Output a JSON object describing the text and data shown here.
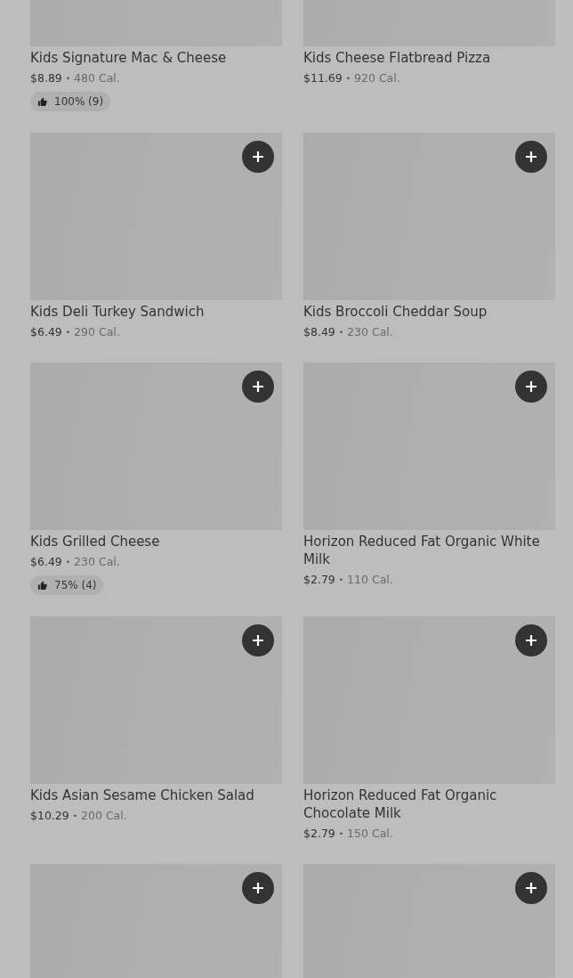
{
  "items": [
    {
      "name": "Kids Signature Mac & Cheese",
      "price": "$8.89",
      "separator": "•",
      "calories": "480 Cal.",
      "rating": "100% (9)"
    },
    {
      "name": "Kids Cheese Flatbread Pizza",
      "price": "$11.69",
      "separator": "•",
      "calories": "920 Cal."
    },
    {
      "name": "Kids Deli Turkey Sandwich",
      "price": "$6.49",
      "separator": "•",
      "calories": "290 Cal.",
      "add_button": true
    },
    {
      "name": "Kids Broccoli Cheddar Soup",
      "price": "$8.49",
      "separator": "•",
      "calories": "230 Cal.",
      "add_button": true
    },
    {
      "name": "Kids Grilled Cheese",
      "price": "$6.49",
      "separator": "•",
      "calories": "230 Cal.",
      "rating": "75% (4)",
      "add_button": true
    },
    {
      "name": "Horizon Reduced Fat Organic White Milk",
      "price": "$2.79",
      "separator": "•",
      "calories": "110 Cal.",
      "add_button": true
    },
    {
      "name": "Kids Asian Sesame Chicken Salad",
      "price": "$10.29",
      "separator": "•",
      "calories": "200 Cal.",
      "add_button": true
    },
    {
      "name": "Horizon Reduced Fat Organic Chocolate Milk",
      "price": "$2.79",
      "separator": "•",
      "calories": "150 Cal.",
      "add_button": true
    },
    {
      "add_button": true
    },
    {
      "add_button": true
    }
  ]
}
